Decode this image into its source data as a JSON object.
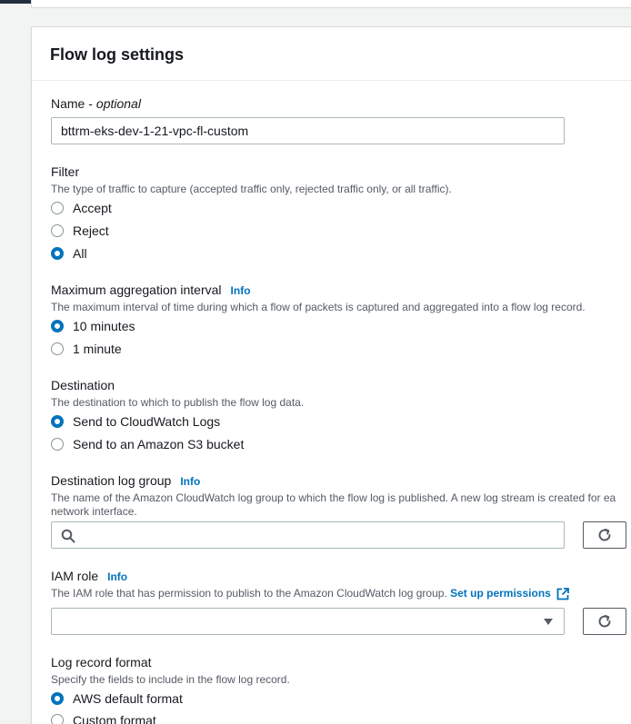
{
  "card": {
    "title": "Flow log settings"
  },
  "name_field": {
    "label": "Name - ",
    "optional": "optional",
    "value": "bttrm-eks-dev-1-21-vpc-fl-custom"
  },
  "filter": {
    "label": "Filter",
    "description": "The type of traffic to capture (accepted traffic only, rejected traffic only, or all traffic).",
    "options": [
      "Accept",
      "Reject",
      "All"
    ],
    "selected": "All"
  },
  "aggregation": {
    "label": "Maximum aggregation interval",
    "info": "Info",
    "description": "The maximum interval of time during which a flow of packets is captured and aggregated into a flow log record.",
    "options": [
      "10 minutes",
      "1 minute"
    ],
    "selected": "10 minutes"
  },
  "destination": {
    "label": "Destination",
    "description": "The destination to which to publish the flow log data.",
    "options": [
      "Send to CloudWatch Logs",
      "Send to an Amazon S3 bucket"
    ],
    "selected": "Send to CloudWatch Logs"
  },
  "log_group": {
    "label": "Destination log group",
    "info": "Info",
    "description_line1": "The name of the Amazon CloudWatch log group to which the flow log is published. A new log stream is created for ea",
    "description_line2": "network interface.",
    "search_icon": "search-icon",
    "refresh_icon": "refresh-icon"
  },
  "iam_role": {
    "label": "IAM role",
    "info": "Info",
    "description": "The IAM role that has permission to publish to the Amazon CloudWatch log group. ",
    "link": "Set up permissions",
    "external_icon": "external-link-icon",
    "refresh_icon": "refresh-icon"
  },
  "log_format": {
    "label": "Log record format",
    "description": "Specify the fields to include in the flow log record.",
    "options": [
      "AWS default format",
      "Custom format"
    ],
    "selected": "AWS default format"
  },
  "colors": {
    "accent": "#0073bb",
    "text": "#16191f",
    "muted": "#545b64",
    "border": "#aab7b8"
  }
}
